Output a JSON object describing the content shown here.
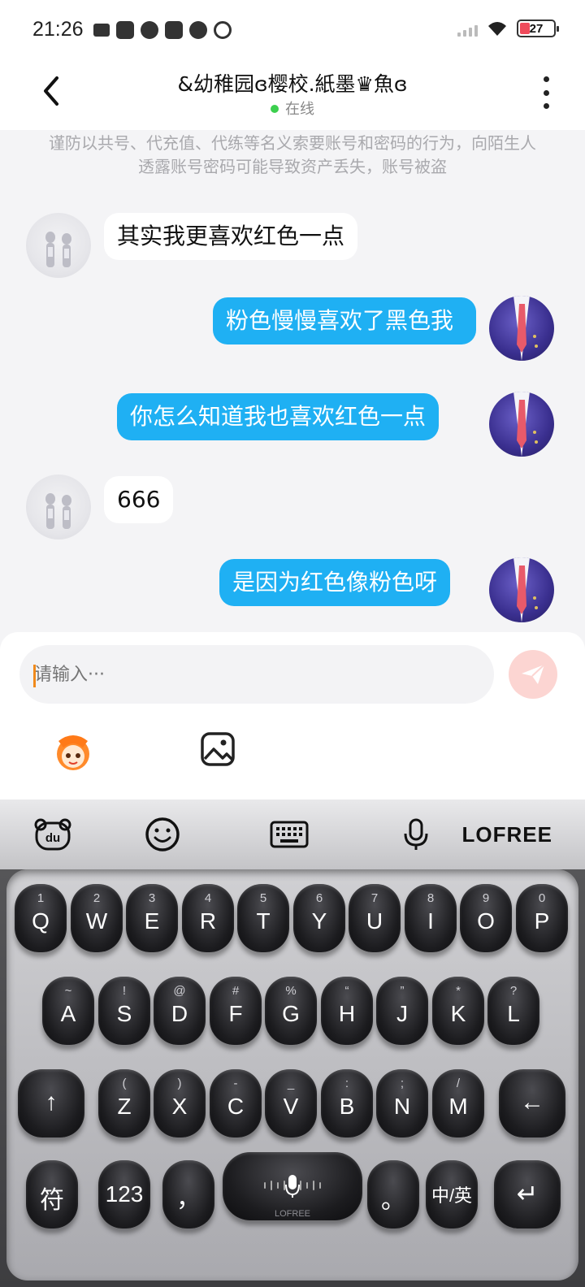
{
  "status_bar": {
    "time": "21:26",
    "battery": "27"
  },
  "header": {
    "title": "&幼稚园ɞ樱校.紙墨♛魚ɞ",
    "status": "在线"
  },
  "notice": "谨防以共号、代充值、代练等名义索要账号和密码的行为，向陌生人透露账号密码可能导致资产丢失，账号被盗",
  "messages": [
    {
      "side": "in",
      "text": "其实我更喜欢红色一点"
    },
    {
      "side": "out",
      "text": "粉色慢慢喜欢了黑色我"
    },
    {
      "side": "out",
      "text": "你怎么知道我也喜欢红色一点"
    },
    {
      "side": "in",
      "text": "666"
    },
    {
      "side": "out",
      "text": "是因为红色像粉色呀"
    }
  ],
  "input": {
    "placeholder": "请输入···"
  },
  "keyboard": {
    "brand": "LOFREE",
    "toolbar": [
      "du-icon",
      "emoji-icon",
      "keyboard-icon",
      "microphone-icon"
    ],
    "row1": [
      {
        "k": "Q",
        "s": "1"
      },
      {
        "k": "W",
        "s": "2"
      },
      {
        "k": "E",
        "s": "3"
      },
      {
        "k": "R",
        "s": "4"
      },
      {
        "k": "T",
        "s": "5"
      },
      {
        "k": "Y",
        "s": "6"
      },
      {
        "k": "U",
        "s": "7"
      },
      {
        "k": "I",
        "s": "8"
      },
      {
        "k": "O",
        "s": "9"
      },
      {
        "k": "P",
        "s": "0"
      }
    ],
    "row2": [
      {
        "k": "A",
        "s": "~"
      },
      {
        "k": "S",
        "s": "!"
      },
      {
        "k": "D",
        "s": "@"
      },
      {
        "k": "F",
        "s": "#"
      },
      {
        "k": "G",
        "s": "%"
      },
      {
        "k": "H",
        "s": "“"
      },
      {
        "k": "J",
        "s": "”"
      },
      {
        "k": "K",
        "s": "*"
      },
      {
        "k": "L",
        "s": "?"
      }
    ],
    "row3": [
      {
        "k": "Z",
        "s": "("
      },
      {
        "k": "X",
        "s": ")"
      },
      {
        "k": "C",
        "s": "-"
      },
      {
        "k": "V",
        "s": "_"
      },
      {
        "k": "B",
        "s": ":"
      },
      {
        "k": "N",
        "s": ";"
      },
      {
        "k": "M",
        "s": "/"
      }
    ],
    "shift": "↑",
    "backspace": "←",
    "symbols": "符",
    "numbers": "123",
    "comma": "，",
    "period": "。",
    "lang": "中/英",
    "enter": "↵",
    "space_mark": "LOFREE"
  }
}
